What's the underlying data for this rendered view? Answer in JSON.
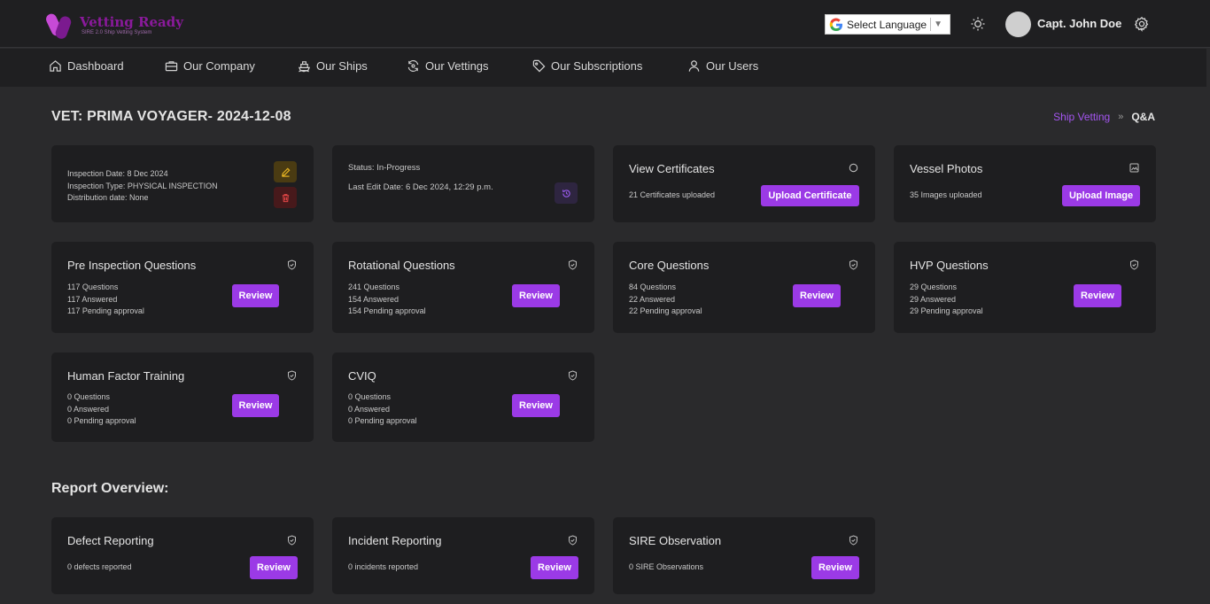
{
  "brand": {
    "name": "Vetting Ready",
    "tagline": "SIRE 2.0 Ship Vetting System"
  },
  "header": {
    "language_label": "Select Language",
    "user_name": "Capt. John Doe"
  },
  "nav": [
    {
      "label": "Dashboard",
      "icon": "home-icon"
    },
    {
      "label": "Our Company",
      "icon": "briefcase-icon"
    },
    {
      "label": "Our Ships",
      "icon": "ship-icon"
    },
    {
      "label": "Our Vettings",
      "icon": "refresh-icon"
    },
    {
      "label": "Our Subscriptions",
      "icon": "tag-icon"
    },
    {
      "label": "Our Users",
      "icon": "user-icon"
    }
  ],
  "page": {
    "title": "VET: PRIMA VOYAGER- 2024-12-08"
  },
  "breadcrumb": {
    "link": "Ship Vetting",
    "separator": "»",
    "current": "Q&A"
  },
  "inspection": {
    "date": "Inspection Date: 8 Dec 2024",
    "type": "Inspection Type: PHYSICAL INSPECTION",
    "distribution": "Distribution date: None"
  },
  "status": {
    "status": "Status: In-Progress",
    "last_edit": "Last Edit Date: 6 Dec 2024, 12:29 p.m."
  },
  "certificates": {
    "title": "View Certificates",
    "count": "21 Certificates uploaded",
    "button": "Upload Certificate"
  },
  "photos": {
    "title": "Vessel Photos",
    "count": "35 Images uploaded",
    "button": "Upload Image"
  },
  "question_sets": [
    {
      "title": "Pre Inspection Questions",
      "questions": "117 Questions",
      "answered": "117 Answered",
      "pending": "117 Pending approval",
      "button": "Review"
    },
    {
      "title": "Rotational Questions",
      "questions": "241 Questions",
      "answered": "154 Answered",
      "pending": "154 Pending approval",
      "button": "Review"
    },
    {
      "title": "Core Questions",
      "questions": "84 Questions",
      "answered": "22 Answered",
      "pending": "22 Pending approval",
      "button": "Review"
    },
    {
      "title": "HVP Questions",
      "questions": "29 Questions",
      "answered": "29 Answered",
      "pending": "29 Pending approval",
      "button": "Review"
    },
    {
      "title": "Human Factor Training",
      "questions": "0 Questions",
      "answered": "0 Answered",
      "pending": "0 Pending approval",
      "button": "Review"
    },
    {
      "title": "CVIQ",
      "questions": "0 Questions",
      "answered": "0 Answered",
      "pending": "0 Pending approval",
      "button": "Review"
    }
  ],
  "report_overview": {
    "title": "Report Overview:",
    "cards": [
      {
        "title": "Defect Reporting",
        "count": "0 defects reported",
        "button": "Review"
      },
      {
        "title": "Incident Reporting",
        "count": "0 incidents reported",
        "button": "Review"
      },
      {
        "title": "SIRE Observation",
        "count": "0 SIRE Observations",
        "button": "Review"
      }
    ]
  },
  "colors": {
    "accent": "#9b3ae6",
    "card_bg": "#1e1e20",
    "page_bg": "#2a2a2c",
    "brand": "#8a1a9b"
  }
}
